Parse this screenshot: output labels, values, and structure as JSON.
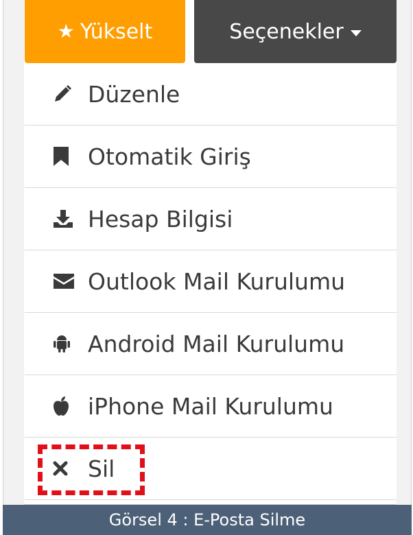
{
  "header": {
    "upgrade_label": "Yükselt",
    "options_label": "Seçenekler"
  },
  "menu": {
    "items": [
      {
        "label": "Düzenle",
        "icon": "pencil-icon"
      },
      {
        "label": "Otomatik Giriş",
        "icon": "bookmark-icon"
      },
      {
        "label": "Hesap Bilgisi",
        "icon": "download-icon"
      },
      {
        "label": "Outlook Mail Kurulumu",
        "icon": "envelope-icon"
      },
      {
        "label": "Android Mail Kurulumu",
        "icon": "android-icon"
      },
      {
        "label": "iPhone Mail Kurulumu",
        "icon": "apple-icon"
      },
      {
        "label": "Sil",
        "icon": "close-icon"
      }
    ]
  },
  "caption": {
    "text": "Görsel 4 : E-Posta Silme"
  },
  "colors": {
    "upgrade_button": "#ff9e00",
    "options_button": "#484848",
    "highlight": "#e0101a",
    "caption_bg": "#4c6077"
  }
}
